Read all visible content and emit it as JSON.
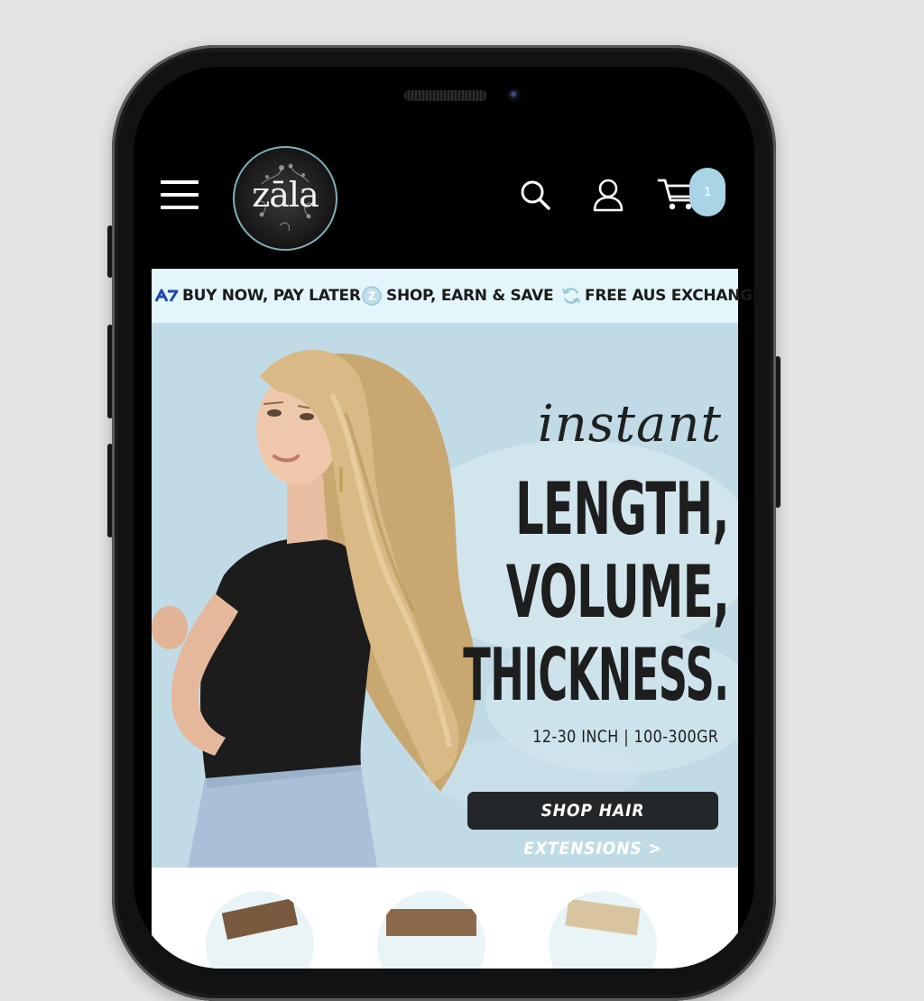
{
  "header": {
    "logo_text": "zāla",
    "cart_count": "1"
  },
  "promo": {
    "items": [
      {
        "label": "BUY NOW, PAY LATER",
        "icon": "afterpay-icon"
      },
      {
        "label": "SHOP, EARN & SAVE",
        "icon": "zip-coin-icon"
      },
      {
        "label": "FREE AUS EXCHANGES",
        "icon": "refresh-icon"
      }
    ]
  },
  "hero": {
    "script_text": "instant",
    "headline": [
      "LENGTH,",
      "VOLUME,",
      "THICKNESS."
    ],
    "specs": "12-30 INCH | 100-300GR",
    "cta_label": "SHOP HAIR EXTENSIONS >"
  },
  "colors": {
    "hero_bg": "#c0dbe5",
    "promo_bg": "#e3f6fb",
    "cart_badge": "#a9d4e6",
    "cta_bg": "#24272a"
  }
}
